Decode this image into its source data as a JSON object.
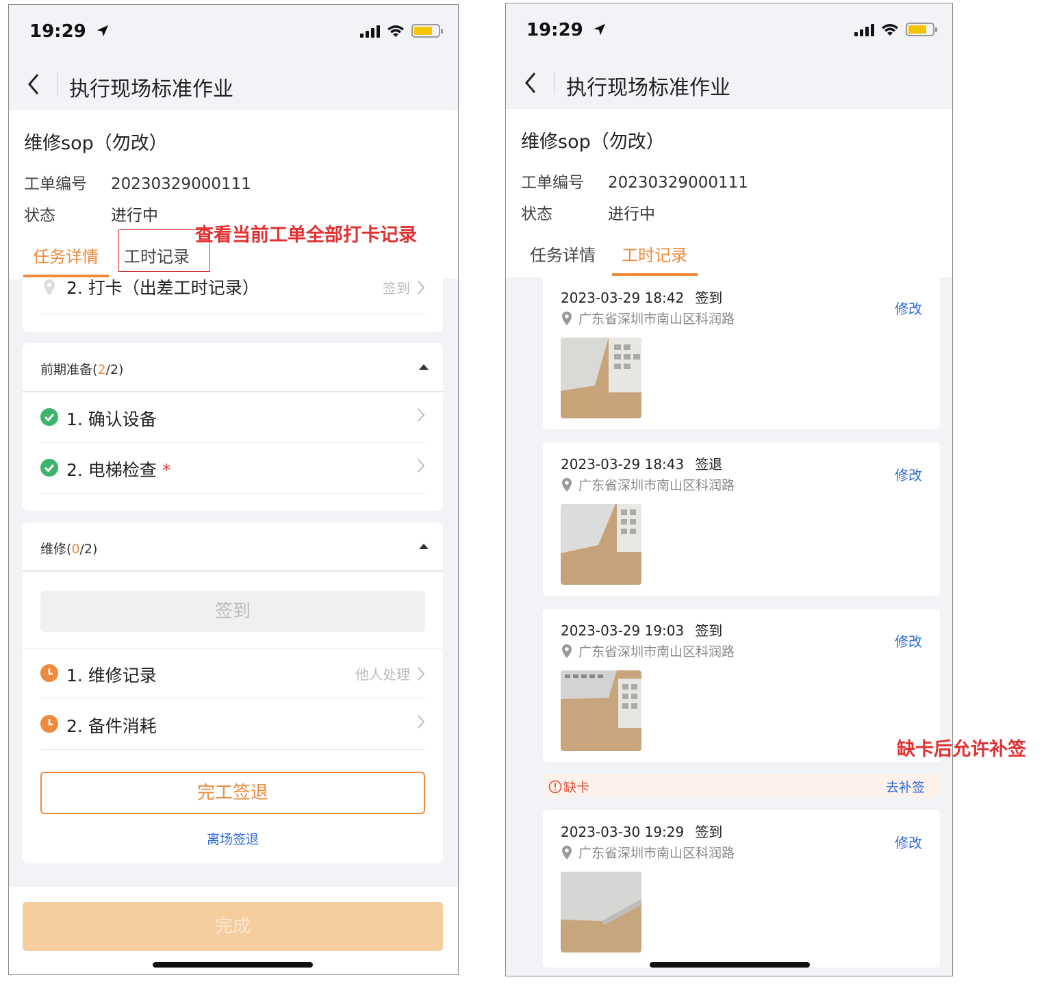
{
  "status_bar": {
    "time": "19:29"
  },
  "nav": {
    "title": "执行现场标准作业"
  },
  "order": {
    "name": "维修sop（勿改）",
    "number_label": "工单编号",
    "number_value": "20230329000111",
    "status_label": "状态",
    "status_value": "进行中"
  },
  "tabs": [
    {
      "label": "任务详情"
    },
    {
      "label": "工时记录"
    }
  ],
  "left": {
    "partial_item": {
      "label": "2. 打卡（出差工时记录）",
      "right": "签到"
    },
    "groups": [
      {
        "title": "前期准备",
        "done": "2",
        "total": "/2)",
        "open": "(",
        "items": [
          {
            "label": "1. 确认设备",
            "status": "done",
            "required": false,
            "right": ""
          },
          {
            "label": "2. 电梯检查",
            "status": "done",
            "required": true,
            "right": ""
          }
        ]
      },
      {
        "title": "维修",
        "done": "0",
        "total": "/2)",
        "open": "(",
        "checkin_button": "签到",
        "items": [
          {
            "label": "1. 维修记录",
            "status": "pending",
            "required": false,
            "right": "他人处理"
          },
          {
            "label": "2. 备件消耗",
            "status": "pending",
            "required": false,
            "right": ""
          }
        ],
        "complete_button": "完工签退",
        "leave_link": "离场签退"
      }
    ],
    "finish_button": "完成",
    "annotation": "查看当前工单全部打卡记录"
  },
  "right": {
    "records": [
      {
        "datetime": "2023-03-29 18:42",
        "kind": "签到",
        "location": "广东省深圳市南山区科润路",
        "edit": "修改"
      },
      {
        "datetime": "2023-03-29 18:43",
        "kind": "签退",
        "location": "广东省深圳市南山区科润路",
        "edit": "修改"
      },
      {
        "datetime": "2023-03-29 19:03",
        "kind": "签到",
        "location": "广东省深圳市南山区科润路",
        "edit": "修改"
      },
      {
        "datetime": "2023-03-30 19:29",
        "kind": "签到",
        "location": "广东省深圳市南山区科润路",
        "edit": "修改"
      }
    ],
    "missing": {
      "label": "缺卡",
      "action": "去补签"
    },
    "annotation": "缺卡后允许补签"
  },
  "colors": {
    "accent": "#ef8a3c",
    "link": "#2d6ad8",
    "done_green": "#3cb56a",
    "annotation_red": "#e23030",
    "finish_disabled": "#f5cd9f"
  },
  "icons": {
    "back": "chevron-left-icon",
    "location_arrow": "location-arrow-icon",
    "signal": "cellular-signal-icon",
    "wifi": "wifi-icon",
    "battery": "battery-charging-icon",
    "pin": "location-pin-icon",
    "done": "check-circle-icon",
    "pending": "clock-icon",
    "chevron": "chevron-right-icon",
    "caret": "caret-up-icon",
    "warning": "warning-circle-icon"
  }
}
